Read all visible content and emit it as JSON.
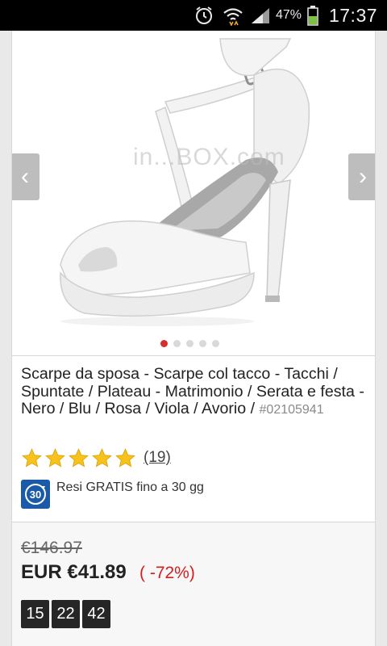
{
  "status_bar": {
    "battery_percent": "47%",
    "clock": "17:37",
    "icons": [
      "alarm-icon",
      "wifi-icon",
      "signal-icon",
      "battery-icon"
    ]
  },
  "gallery": {
    "watermark": "in...BOX.com",
    "prev_icon": "‹",
    "next_icon": "›",
    "dot_count": 5,
    "active_dot_index": 0,
    "colors": {
      "active_dot": "#d32f2f",
      "inactive_dot": "#d9d9d9",
      "arrow_bg": "#bdbdbd"
    }
  },
  "product": {
    "title": "Scarpe da sposa - Scarpe col tacco - Tacchi / Spuntate / Plateau - Matrimonio / Serata e festa -Nero / Blu / Rosa / Viola / Avorio / ",
    "sku": "#02105941",
    "rating": {
      "stars": 5,
      "count_label": "(19)"
    },
    "returns": {
      "badge": "30",
      "text": "Resi GRATIS fino a 30 gg",
      "badge_color": "#1b5aa8"
    }
  },
  "pricing": {
    "old_price": "€146.97",
    "new_price": "EUR €41.89",
    "discount": "( -72%)",
    "discount_color": "#d21e1e",
    "countdown": {
      "hours": "15",
      "minutes": "22",
      "seconds": "42"
    }
  }
}
